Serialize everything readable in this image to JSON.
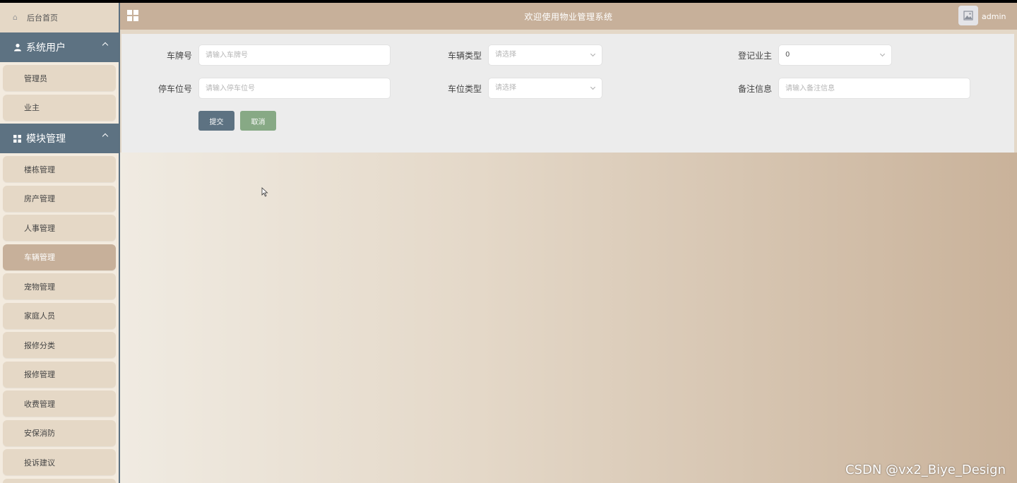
{
  "header": {
    "title": "欢迎使用物业管理系统",
    "username": "admin"
  },
  "sidebar": {
    "home": "后台首页",
    "groups": [
      {
        "title": "系统用户",
        "items": [
          "管理员",
          "业主"
        ]
      },
      {
        "title": "模块管理",
        "items": [
          "楼栋管理",
          "房产管理",
          "人事管理",
          "车辆管理",
          "宠物管理",
          "家庭人员",
          "报修分类",
          "报修管理",
          "收费管理",
          "安保消防",
          "投诉建议"
        ]
      }
    ],
    "active_item": "车辆管理"
  },
  "form": {
    "plate": {
      "label": "车牌号",
      "placeholder": "请输入车牌号"
    },
    "vehicle_type": {
      "label": "车辆类型",
      "placeholder": "请选择"
    },
    "owner": {
      "label": "登记业主",
      "value": "0"
    },
    "parking": {
      "label": "停车位号",
      "placeholder": "请输入停车位号"
    },
    "spot_type": {
      "label": "车位类型",
      "placeholder": "请选择"
    },
    "remark": {
      "label": "备注信息",
      "placeholder": "请输入备注信息"
    },
    "submit": "提交",
    "cancel": "取消"
  },
  "watermark": "CSDN @vx2_Biye_Design",
  "colors": {
    "header": "#c7b09a",
    "sidebar_group": "#5d7282",
    "submit": "#5d7282",
    "cancel": "#87a985"
  }
}
